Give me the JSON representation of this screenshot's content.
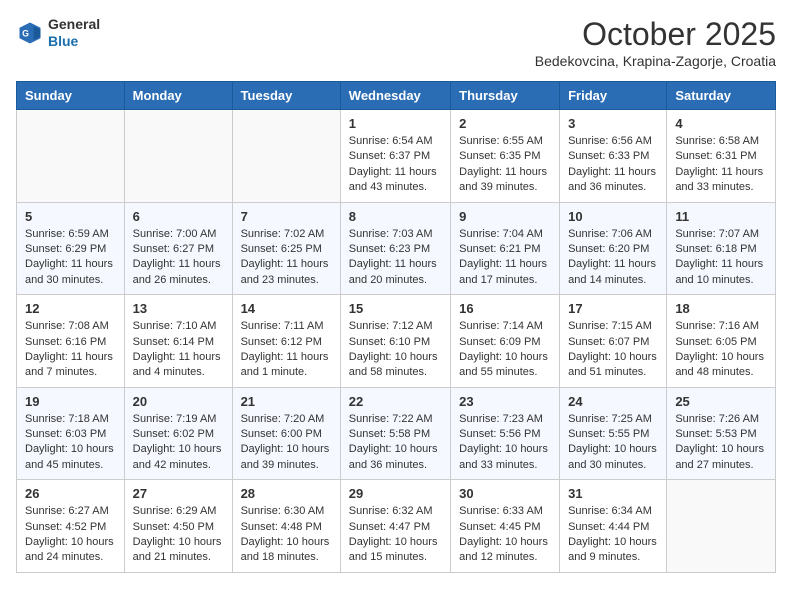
{
  "header": {
    "logo_line1": "General",
    "logo_line2": "Blue",
    "month_year": "October 2025",
    "location": "Bedekovcina, Krapina-Zagorje, Croatia"
  },
  "weekdays": [
    "Sunday",
    "Monday",
    "Tuesday",
    "Wednesday",
    "Thursday",
    "Friday",
    "Saturday"
  ],
  "weeks": [
    [
      {
        "day": "",
        "info": ""
      },
      {
        "day": "",
        "info": ""
      },
      {
        "day": "",
        "info": ""
      },
      {
        "day": "1",
        "info": "Sunrise: 6:54 AM\nSunset: 6:37 PM\nDaylight: 11 hours\nand 43 minutes."
      },
      {
        "day": "2",
        "info": "Sunrise: 6:55 AM\nSunset: 6:35 PM\nDaylight: 11 hours\nand 39 minutes."
      },
      {
        "day": "3",
        "info": "Sunrise: 6:56 AM\nSunset: 6:33 PM\nDaylight: 11 hours\nand 36 minutes."
      },
      {
        "day": "4",
        "info": "Sunrise: 6:58 AM\nSunset: 6:31 PM\nDaylight: 11 hours\nand 33 minutes."
      }
    ],
    [
      {
        "day": "5",
        "info": "Sunrise: 6:59 AM\nSunset: 6:29 PM\nDaylight: 11 hours\nand 30 minutes."
      },
      {
        "day": "6",
        "info": "Sunrise: 7:00 AM\nSunset: 6:27 PM\nDaylight: 11 hours\nand 26 minutes."
      },
      {
        "day": "7",
        "info": "Sunrise: 7:02 AM\nSunset: 6:25 PM\nDaylight: 11 hours\nand 23 minutes."
      },
      {
        "day": "8",
        "info": "Sunrise: 7:03 AM\nSunset: 6:23 PM\nDaylight: 11 hours\nand 20 minutes."
      },
      {
        "day": "9",
        "info": "Sunrise: 7:04 AM\nSunset: 6:21 PM\nDaylight: 11 hours\nand 17 minutes."
      },
      {
        "day": "10",
        "info": "Sunrise: 7:06 AM\nSunset: 6:20 PM\nDaylight: 11 hours\nand 14 minutes."
      },
      {
        "day": "11",
        "info": "Sunrise: 7:07 AM\nSunset: 6:18 PM\nDaylight: 11 hours\nand 10 minutes."
      }
    ],
    [
      {
        "day": "12",
        "info": "Sunrise: 7:08 AM\nSunset: 6:16 PM\nDaylight: 11 hours\nand 7 minutes."
      },
      {
        "day": "13",
        "info": "Sunrise: 7:10 AM\nSunset: 6:14 PM\nDaylight: 11 hours\nand 4 minutes."
      },
      {
        "day": "14",
        "info": "Sunrise: 7:11 AM\nSunset: 6:12 PM\nDaylight: 11 hours\nand 1 minute."
      },
      {
        "day": "15",
        "info": "Sunrise: 7:12 AM\nSunset: 6:10 PM\nDaylight: 10 hours\nand 58 minutes."
      },
      {
        "day": "16",
        "info": "Sunrise: 7:14 AM\nSunset: 6:09 PM\nDaylight: 10 hours\nand 55 minutes."
      },
      {
        "day": "17",
        "info": "Sunrise: 7:15 AM\nSunset: 6:07 PM\nDaylight: 10 hours\nand 51 minutes."
      },
      {
        "day": "18",
        "info": "Sunrise: 7:16 AM\nSunset: 6:05 PM\nDaylight: 10 hours\nand 48 minutes."
      }
    ],
    [
      {
        "day": "19",
        "info": "Sunrise: 7:18 AM\nSunset: 6:03 PM\nDaylight: 10 hours\nand 45 minutes."
      },
      {
        "day": "20",
        "info": "Sunrise: 7:19 AM\nSunset: 6:02 PM\nDaylight: 10 hours\nand 42 minutes."
      },
      {
        "day": "21",
        "info": "Sunrise: 7:20 AM\nSunset: 6:00 PM\nDaylight: 10 hours\nand 39 minutes."
      },
      {
        "day": "22",
        "info": "Sunrise: 7:22 AM\nSunset: 5:58 PM\nDaylight: 10 hours\nand 36 minutes."
      },
      {
        "day": "23",
        "info": "Sunrise: 7:23 AM\nSunset: 5:56 PM\nDaylight: 10 hours\nand 33 minutes."
      },
      {
        "day": "24",
        "info": "Sunrise: 7:25 AM\nSunset: 5:55 PM\nDaylight: 10 hours\nand 30 minutes."
      },
      {
        "day": "25",
        "info": "Sunrise: 7:26 AM\nSunset: 5:53 PM\nDaylight: 10 hours\nand 27 minutes."
      }
    ],
    [
      {
        "day": "26",
        "info": "Sunrise: 6:27 AM\nSunset: 4:52 PM\nDaylight: 10 hours\nand 24 minutes."
      },
      {
        "day": "27",
        "info": "Sunrise: 6:29 AM\nSunset: 4:50 PM\nDaylight: 10 hours\nand 21 minutes."
      },
      {
        "day": "28",
        "info": "Sunrise: 6:30 AM\nSunset: 4:48 PM\nDaylight: 10 hours\nand 18 minutes."
      },
      {
        "day": "29",
        "info": "Sunrise: 6:32 AM\nSunset: 4:47 PM\nDaylight: 10 hours\nand 15 minutes."
      },
      {
        "day": "30",
        "info": "Sunrise: 6:33 AM\nSunset: 4:45 PM\nDaylight: 10 hours\nand 12 minutes."
      },
      {
        "day": "31",
        "info": "Sunrise: 6:34 AM\nSunset: 4:44 PM\nDaylight: 10 hours\nand 9 minutes."
      },
      {
        "day": "",
        "info": ""
      }
    ]
  ]
}
